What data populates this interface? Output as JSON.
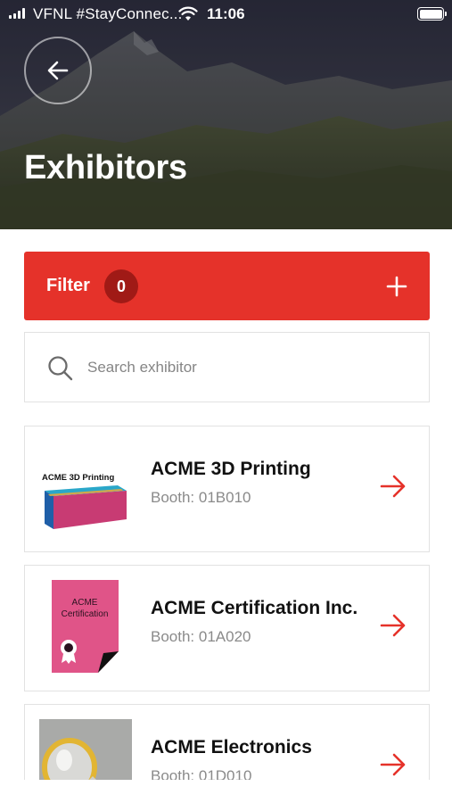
{
  "status_bar": {
    "carrier": "VFNL #StayConnec...",
    "time": "11:06",
    "signal_icon": "cellular-signal-icon",
    "wifi_icon": "wifi-icon",
    "battery_icon": "battery-icon"
  },
  "header": {
    "back_icon": "arrow-left-icon",
    "title": "Exhibitors"
  },
  "filter": {
    "label": "Filter",
    "count": "0",
    "add_icon": "plus-icon",
    "color": "#e5322a"
  },
  "search": {
    "placeholder": "Search exhibitor",
    "value": "",
    "icon": "search-icon"
  },
  "exhibitors": [
    {
      "name": "ACME 3D Printing",
      "booth": "Booth: 01B010",
      "logo_text": "ACME 3D Printing"
    },
    {
      "name": "ACME Certification Inc.",
      "booth": "Booth: 01A020",
      "logo_text_line1": "ACME",
      "logo_text_line2": "Certification"
    },
    {
      "name": "ACME Electronics",
      "booth": "Booth: 01D010"
    }
  ],
  "colors": {
    "accent": "#e5322a",
    "badge": "#a01a16",
    "text_secondary": "#8a8a8a"
  }
}
